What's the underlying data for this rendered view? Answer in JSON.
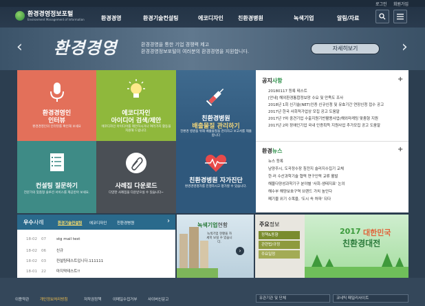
{
  "util": {
    "login": "로그인",
    "join": "회원가입"
  },
  "logo": {
    "title": "환경경영정보포털",
    "sub": "Environment Management of Information"
  },
  "nav": [
    "환경경영",
    "환경기술컨설팅",
    "에코디자인",
    "친환경병원",
    "녹색기업",
    "알림/자료"
  ],
  "hero": {
    "title": "환경경영",
    "line1": "환경경영을 통한 기업 경쟁력 제고",
    "line2": "환경경영정보포털이 여러분의 환경경영을 지원합니다.",
    "more": "자세히보기"
  },
  "tiles": {
    "t1": {
      "title": "환경경영인",
      "title2": "인터뷰",
      "desc": "환경경영인의 인터뷰를 확인해 보세요"
    },
    "t2": {
      "title": "에코디자인",
      "title2": "아이디어 검색/제안",
      "desc": "에코디자인 아이디어를 제안하시거나 여러가지 활동을 지원해 드립니다."
    },
    "t3": {
      "title": "친환경병원",
      "title2": "배출물질 관리하기",
      "desc": "친환경 병원을 위해 배출물질을 관리하고 보고서를 제출합니다"
    },
    "t4": {
      "title": "컨설팅 질문하기",
      "desc": "전문가의 맞춤형 솔루션 서비스를 제공받아 보세요."
    },
    "t5": {
      "title": "사례집 다운로드",
      "desc": "다양한 사례집을 다운받으실 수 있습니다~"
    },
    "t6": {
      "title": "친환경병원 자가진단",
      "desc": "환경경영평가를 진행하시고 평가할 수 있습니다."
    }
  },
  "notice": {
    "title_a": "공지",
    "title_b": "사항",
    "items": [
      "20180117 등록 테스트",
      "[안내] 해외환경통합정보망 수요 및 만족도 조사",
      "2018년 1회 신기술(NET)인증 신규신청 및 유효기간 연장신청 접수 공고",
      "2017년 한국 사회적가업상 모집 공고 도움말",
      "2017년 7차 중견기업 수출지원기반활용사업(해외마케팅 맞춤형 지원",
      "2017년 2차 장애인기업 국내 인증획득 지원사업 추가모집 공고 도움말"
    ]
  },
  "news": {
    "title_a": "환경",
    "title_b": "뉴스",
    "items": [
      "뉴스 등록",
      "남양주시, 도곡정수장 침전지 슬러지수집기 교체",
      "한·러 수산과학기술 협력 연구인력 교류 활발",
      "해물다양성과학기구 분야별 '사회-생태지표' 논의",
      "해수부 해양보호구역 브랜드 가치 높인다",
      "폐기물 위기 수목을, '도시 속 허파' 되다"
    ]
  },
  "cases": {
    "title_a": "우수",
    "title_b": "사례",
    "tabs": [
      "환경기술컨설팅",
      "에코디자인",
      "친환경병원"
    ],
    "rows": [
      {
        "date": "18-02",
        "num": "07",
        "text": "stg mail test"
      },
      {
        "date": "18-02",
        "num": "06",
        "text": "신규"
      },
      {
        "date": "18-02",
        "num": "03",
        "text": "컨설팅테스트입니다.111111"
      },
      {
        "date": "18-01",
        "num": "22",
        "text": "마지막테스트!!"
      }
    ]
  },
  "green_biz": {
    "title_a": "녹색기업",
    "title_b": "현황",
    "desc": "녹색기업 현황을 자세히 보실 수 있습니다."
  },
  "major": {
    "title_a": "주요",
    "title_b": "정보",
    "items": [
      "정책&동향",
      "관련법/규정",
      "주요일정"
    ]
  },
  "promo": {
    "year": "2017",
    "line1": "대한민국",
    "line2": "친환경대전"
  },
  "footer": {
    "links": [
      "이용약관",
      "개인정보처리방침",
      "저작권정책",
      "이메일수집거부",
      "사이버신문고"
    ],
    "select1": "유관기관 및 단체",
    "select2": "코네틱 패밀리사이트"
  }
}
